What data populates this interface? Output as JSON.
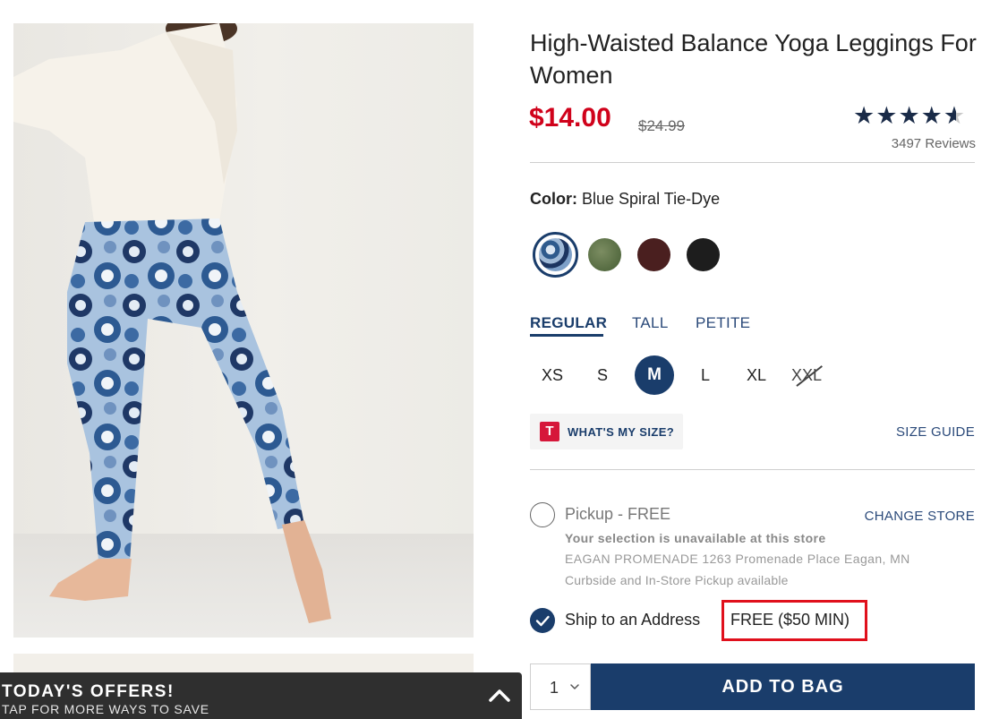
{
  "product": {
    "title": "High-Waisted Balance Yoga Leggings For Women",
    "sale_price": "$14.00",
    "original_price": "$24.99",
    "rating": 4.5,
    "rating_stars_max": 5,
    "reviews": "3497 Reviews"
  },
  "color": {
    "label": "Color:",
    "selected": "Blue Spiral Tie-Dye",
    "swatches": [
      {
        "name": "Blue Spiral Tie-Dye",
        "color": "#2e5a8c",
        "selected": true
      },
      {
        "name": "olive",
        "color": "#556b41",
        "selected": false
      },
      {
        "name": "burgundy",
        "color": "#4a1f1f",
        "selected": false
      },
      {
        "name": "black",
        "color": "#1d1d1d",
        "selected": false
      }
    ]
  },
  "fit_tabs": [
    {
      "label": "REGULAR",
      "active": true
    },
    {
      "label": "TALL",
      "active": false
    },
    {
      "label": "PETITE",
      "active": false
    }
  ],
  "sizes": [
    {
      "label": "XS",
      "selected": false,
      "available": true
    },
    {
      "label": "S",
      "selected": false,
      "available": true
    },
    {
      "label": "M",
      "selected": true,
      "available": true
    },
    {
      "label": "L",
      "selected": false,
      "available": true
    },
    {
      "label": "XL",
      "selected": false,
      "available": true
    },
    {
      "label": "XXL",
      "selected": false,
      "available": false
    }
  ],
  "size_help": {
    "logo_letter": "T",
    "whats_my_size": "WHAT'S MY SIZE?",
    "size_guide": "SIZE GUIDE"
  },
  "fulfillment": {
    "pickup": {
      "label": "Pickup - FREE",
      "change_store": "CHANGE STORE",
      "unavailable": "Your selection is unavailable at this store",
      "store_address": "EAGAN PROMENADE 1263 Promenade Place  Eagan, MN",
      "curbside": "Curbside and In-Store Pickup available",
      "selected": false
    },
    "ship": {
      "label": "Ship to an Address",
      "price": "FREE ($50 MIN)",
      "selected": true
    }
  },
  "purchase": {
    "quantity": "1",
    "add_to_bag": "ADD TO BAG"
  },
  "offers": {
    "title": "TODAY'S OFFERS!",
    "subtitle": "TAP FOR MORE WAYS TO SAVE"
  },
  "colors": {
    "brand_navy": "#1a3d6b",
    "sale_red": "#d0021b",
    "highlight_red": "#e0101c"
  },
  "icons": {
    "offers_toggle": "chevron-up-icon",
    "qty_caret": "chevron-down-icon",
    "ship_check": "checkmark-icon",
    "rating": "star-icon"
  }
}
